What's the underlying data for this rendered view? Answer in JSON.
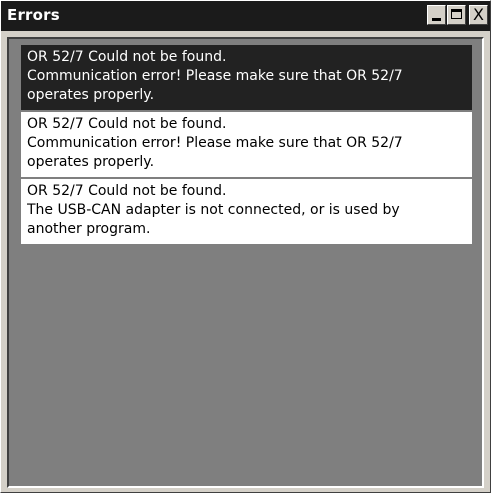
{
  "window": {
    "title": "Errors",
    "buttons": {
      "minimize": "_",
      "maximize": "□",
      "close": "X"
    }
  },
  "errors": [
    {
      "lines": [
        "OR 52/7 Could not be found.",
        "Communication error! Please make sure that OR 52/7",
        "operates properly."
      ],
      "selected": true
    },
    {
      "lines": [
        "OR 52/7 Could not be found.",
        "Communication error! Please make sure that OR 52/7",
        "operates properly."
      ],
      "selected": false
    },
    {
      "lines": [
        "OR 52/7 Could not be found.",
        "The USB-CAN adapter is not connected, or is used by",
        "another program."
      ],
      "selected": false
    }
  ],
  "colors": {
    "title_bar": "#1b1b1b",
    "selected_row": "#222222",
    "client_background": "#7f7f7f"
  }
}
